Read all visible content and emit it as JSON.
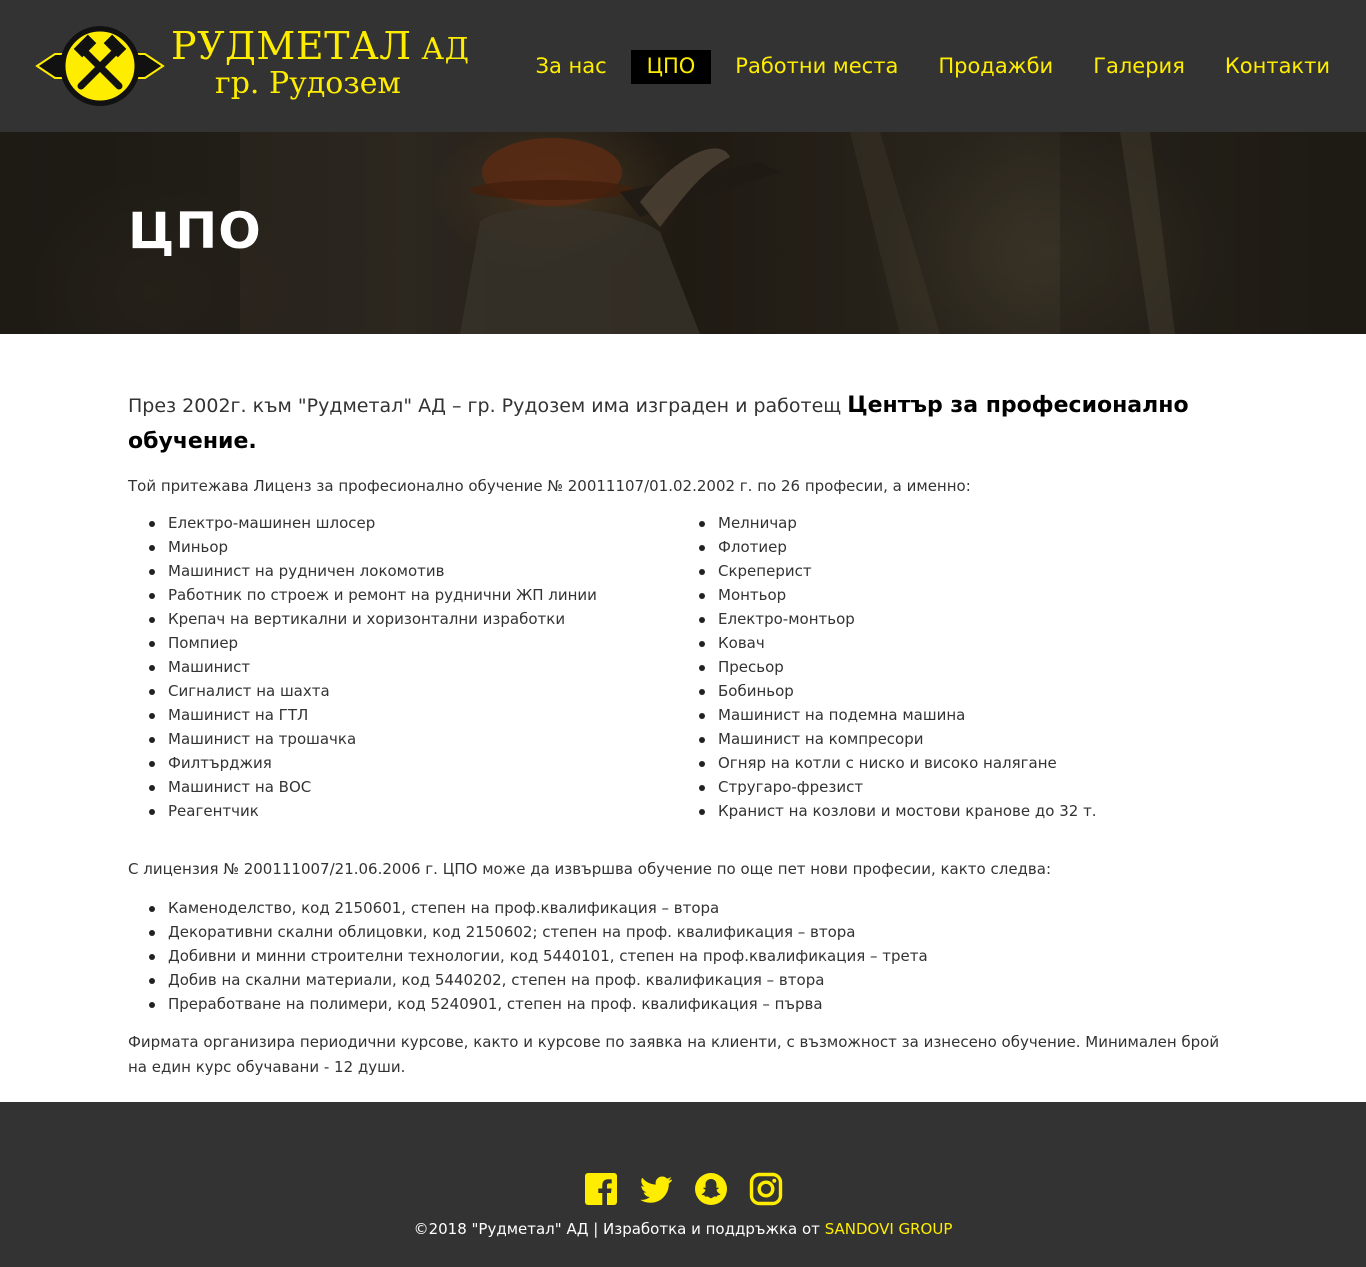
{
  "header": {
    "logo_title": "РУДМЕТАЛ",
    "logo_title_suffix": "АД",
    "logo_subtitle": "гр. Рудозем",
    "nav": [
      {
        "label": "За нас",
        "active": false
      },
      {
        "label": "ЦПО",
        "active": true
      },
      {
        "label": "Работни места",
        "active": false
      },
      {
        "label": "Продажби",
        "active": false
      },
      {
        "label": "Галерия",
        "active": false
      },
      {
        "label": "Контакти",
        "active": false
      }
    ]
  },
  "hero": {
    "title": "ЦПО"
  },
  "content": {
    "intro_text": "През 2002г. към \"Рудметал\" АД – гр. Рудозем има изграден и работещ ",
    "intro_strong": "Център за професионално обучение.",
    "license_text": "Той притежава Лиценз за професионално обучение № 20011107/01.02.2002 г. по 26 професии, а именно:",
    "professions_left": [
      "Електро-машинен шлосер",
      "Миньор",
      "Машинист на рудничен локомотив",
      "Работник по строеж и ремонт на руднични ЖП линии",
      "Крепач на вертикални и хоризонтални изработки",
      "Помпиер",
      "Машинист",
      "Сигналист на шахта",
      "Машинист на ГТЛ",
      "Машинист на трошачка",
      "Филтърджия",
      "Машинист на ВОС",
      "Реагентчик"
    ],
    "professions_right": [
      "Мелничар",
      "Флотиер",
      "Скреперист",
      "Монтьор",
      "Електро-монтьор",
      "Ковач",
      "Пресьор",
      "Бобиньор",
      "Машинист на подемна машина",
      "Машинист на компресори",
      "Огняр на котли с ниско и високо налягане",
      "Стругаро-фрезист",
      "Кранист на козлови и мостови кранове до 32 т."
    ],
    "license2_text": "С лицензия № 200111007/21.06.2006 г. ЦПО може да извършва обучение по още пет нови професии, както следва:",
    "new_professions": [
      "Каменоделство, код 2150601, степен на проф.квалификация – втора",
      "Декоративни скални облицовки, код 2150602; степен на проф. квалификация – втора",
      "Добивни и минни строителни технологии, код 5440101, степен на проф.квалификация – трета",
      "Добив на скални материали, код 5440202, степен на проф. квалификация – втора",
      "Преработване на полимери, код 5240901, степен на проф. квалификация – първа"
    ],
    "firm_text": "Фирмата организира периодични курсове, както и курсове по заявка на клиенти, с възможност за изнесено обучение. Минимален брой на един курс обучавани - 12 души."
  },
  "footer": {
    "social": [
      "facebook-icon",
      "twitter-icon",
      "snapchat-icon",
      "instagram-icon"
    ],
    "copyright": "©2018 \"Рудметал\" АД | Изработка и поддръжка от ",
    "credit_link": "SANDOVI GROUP"
  },
  "colors": {
    "accent": "#ffed00",
    "header_bg": "#333333",
    "footer_bg": "#333333",
    "active_nav_bg": "#000000"
  }
}
